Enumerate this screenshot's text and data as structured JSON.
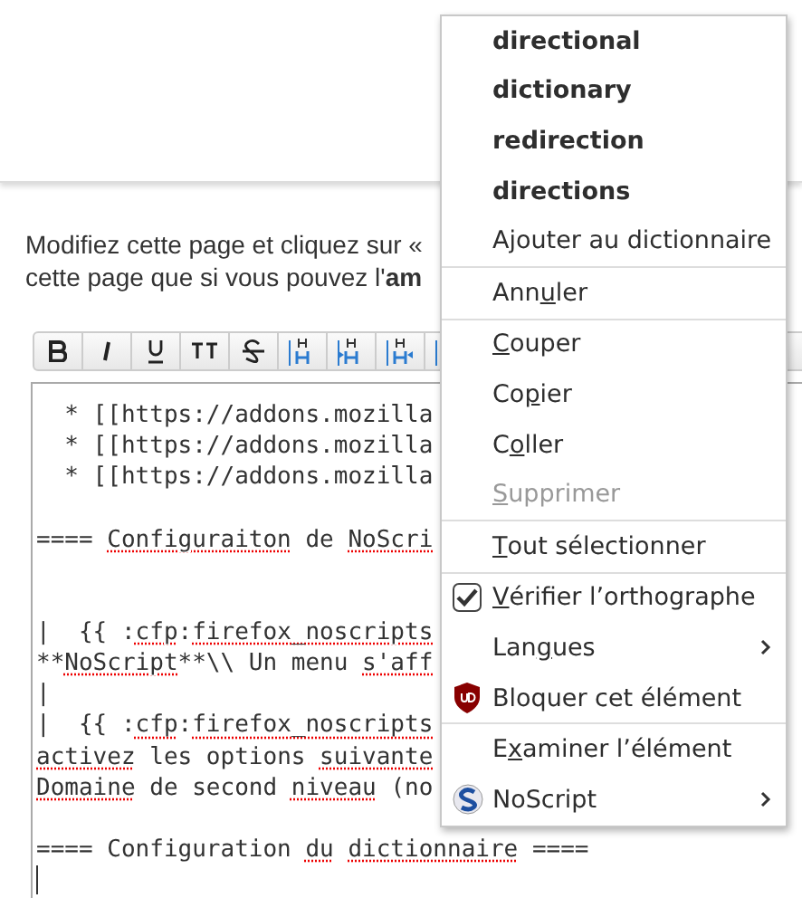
{
  "intro": [
    "Modifiez cette page et cliquez sur «",
    "cette page que si vous pouvez l'**am**"
  ],
  "toolbar": [
    {
      "kind": "bold"
    },
    {
      "kind": "italic"
    },
    {
      "kind": "underline"
    },
    {
      "kind": "mono"
    },
    {
      "kind": "strike"
    },
    {
      "kind": "h-same"
    },
    {
      "kind": "h-lower"
    },
    {
      "kind": "h-higher"
    },
    {
      "kind": "h-partial"
    }
  ],
  "editor": {
    "lines": [
      {
        "kind": "text",
        "segments": [
          {
            "t": "  * [[https://addons.mozilla",
            "misspelled": false
          }
        ]
      },
      {
        "kind": "text",
        "segments": [
          {
            "t": "  * [[https://addons.mozilla",
            "misspelled": false
          }
        ]
      },
      {
        "kind": "text",
        "segments": [
          {
            "t": "  * [[https://addons.mozilla",
            "misspelled": false
          }
        ]
      },
      {
        "kind": "blank"
      },
      {
        "kind": "text",
        "segments": [
          {
            "t": "==== ",
            "misspelled": false
          },
          {
            "t": "Configuraiton",
            "misspelled": true
          },
          {
            "t": " de ",
            "misspelled": false
          },
          {
            "t": "NoScri",
            "misspelled": true
          }
        ]
      },
      {
        "kind": "blank"
      },
      {
        "kind": "blank"
      },
      {
        "kind": "text",
        "segments": [
          {
            "t": "|  {{ :",
            "misspelled": false
          },
          {
            "t": "cfp",
            "misspelled": true
          },
          {
            "t": ":",
            "misspelled": false
          },
          {
            "t": "firefox_noscripts",
            "misspelled": true
          }
        ]
      },
      {
        "kind": "text",
        "segments": [
          {
            "t": "**",
            "misspelled": false
          },
          {
            "t": "NoScript",
            "misspelled": true
          },
          {
            "t": "**\\\\ Un menu ",
            "misspelled": false
          },
          {
            "t": "s'aff",
            "misspelled": true
          }
        ]
      },
      {
        "kind": "text",
        "segments": [
          {
            "t": "|",
            "misspelled": false
          }
        ]
      },
      {
        "kind": "text",
        "segments": [
          {
            "t": "|  {{ :",
            "misspelled": false
          },
          {
            "t": "cfp",
            "misspelled": true
          },
          {
            "t": ":",
            "misspelled": false
          },
          {
            "t": "firefox_noscripts",
            "misspelled": true
          }
        ]
      },
      {
        "kind": "text",
        "segments": [
          {
            "t": "activez",
            "misspelled": true
          },
          {
            "t": " les options ",
            "misspelled": false
          },
          {
            "t": "suivante",
            "misspelled": true
          }
        ]
      },
      {
        "kind": "text",
        "segments": [
          {
            "t": "Domaine",
            "misspelled": true
          },
          {
            "t": " de second ",
            "misspelled": false
          },
          {
            "t": "niveau",
            "misspelled": true
          },
          {
            "t": " (no",
            "misspelled": false
          }
        ]
      },
      {
        "kind": "blank"
      },
      {
        "kind": "text",
        "segments": [
          {
            "t": "==== Configuration ",
            "misspelled": false
          },
          {
            "t": "du",
            "misspelled": true
          },
          {
            "t": " dictionnaire",
            "misspelled": true
          },
          {
            "t": " ====",
            "misspelled": false
          }
        ]
      }
    ]
  },
  "context_menu": [
    {
      "kind": "suggestion",
      "label": "directional"
    },
    {
      "kind": "suggestion",
      "label": "dictionary"
    },
    {
      "kind": "suggestion",
      "label": "redirection"
    },
    {
      "kind": "suggestion",
      "label": "directions"
    },
    {
      "kind": "item",
      "label": "Ajouter au dictionnaire",
      "disabled": false
    },
    {
      "kind": "separator"
    },
    {
      "kind": "item",
      "before": "Ann",
      "accesskey": "u",
      "after": "ler",
      "disabled": false
    },
    {
      "kind": "separator"
    },
    {
      "kind": "item",
      "accesskey": "C",
      "after": "ouper",
      "disabled": false
    },
    {
      "kind": "item",
      "before": "Co",
      "accesskey": "p",
      "after": "ier",
      "disabled": false
    },
    {
      "kind": "item",
      "before": "C",
      "accesskey": "o",
      "after": "ller",
      "disabled": false
    },
    {
      "kind": "item",
      "accesskey": "S",
      "after": "upprimer",
      "disabled": true
    },
    {
      "kind": "separator"
    },
    {
      "kind": "item",
      "accesskey": "T",
      "after": "out sélectionner",
      "disabled": false
    },
    {
      "kind": "separator"
    },
    {
      "kind": "check-item",
      "accesskey": "V",
      "after": "érifier l’orthographe",
      "disabled": false,
      "checked": true
    },
    {
      "kind": "submenu-item",
      "before": "Lan",
      "accesskey": "g",
      "after": "ues",
      "disabled": false
    },
    {
      "kind": "shield-item",
      "label": "Bloquer cet élément",
      "disabled": false
    },
    {
      "kind": "separator"
    },
    {
      "kind": "item",
      "before": "E",
      "accesskey": "x",
      "after": "aminer l’élément",
      "disabled": false
    },
    {
      "kind": "badge-submenu-item",
      "label": "NoScript",
      "disabled": false
    }
  ]
}
